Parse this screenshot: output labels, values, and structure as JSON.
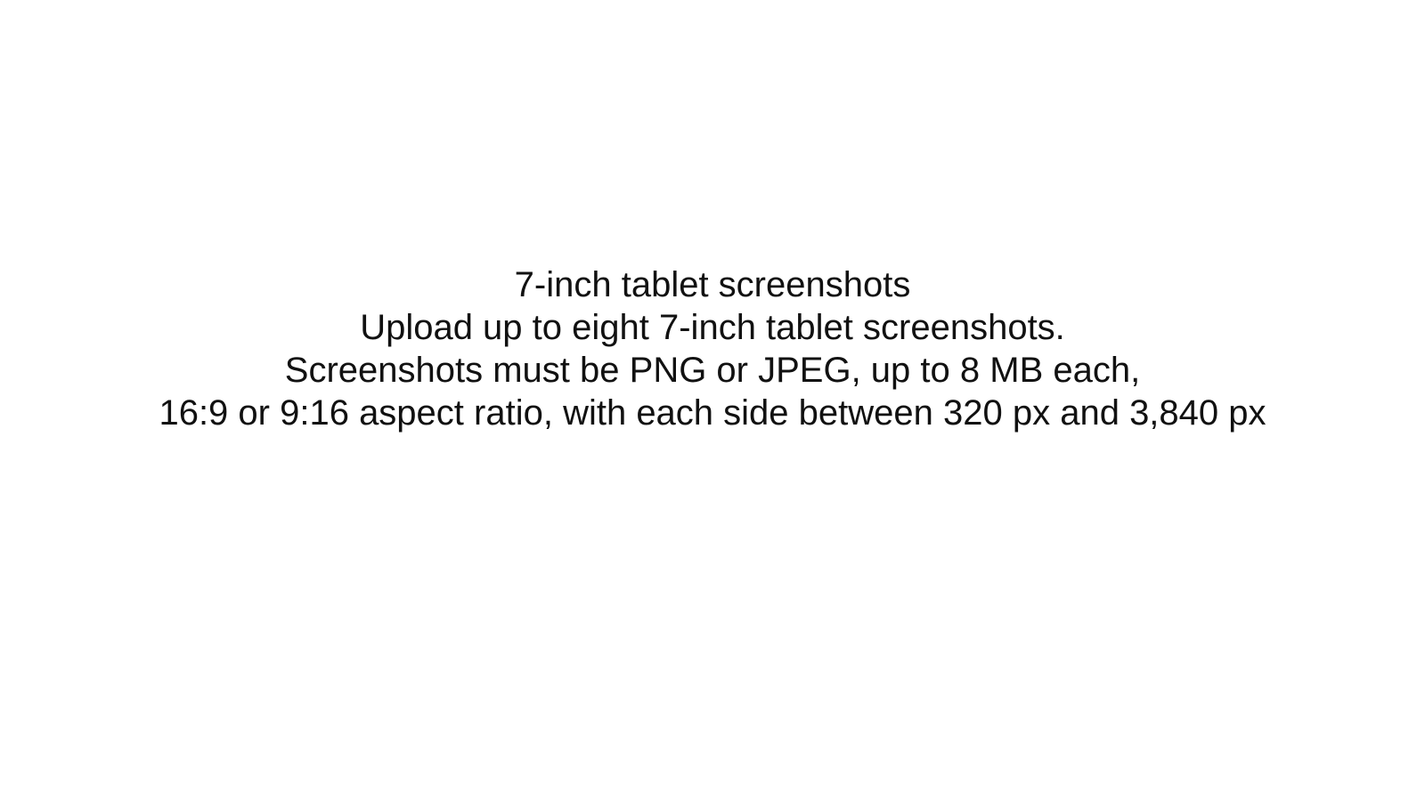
{
  "section": {
    "title": "7-inch tablet screenshots",
    "description": "Upload up to eight 7-inch tablet screenshots.",
    "requirements_line1": "Screenshots must be PNG or JPEG, up to 8 MB each,",
    "requirements_line2": "16:9 or 9:16 aspect ratio, with each side between 320 px and 3,840 px"
  }
}
